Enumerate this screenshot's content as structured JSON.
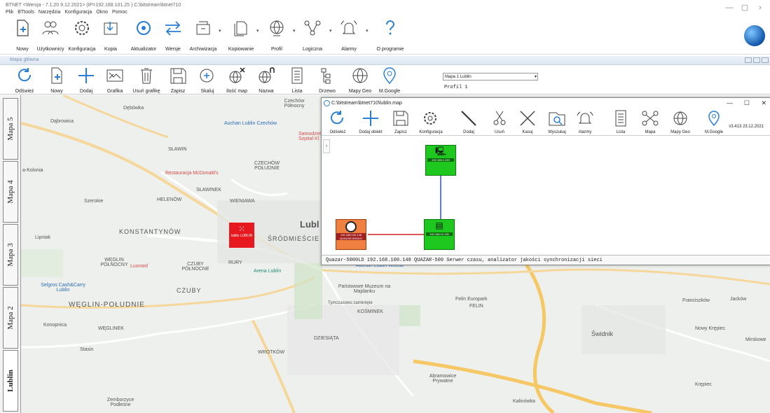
{
  "app": {
    "title": "BTNET   <Wersja - 7.1.20 9.12.2021>  (IP=192.168.101.25 )  C:\\bitstream\\btnet710",
    "menu": [
      "Plik",
      "BTtools",
      "Narzędzia",
      "Konfiguracja",
      "Okno",
      "Pomoc"
    ]
  },
  "main_toolbar": [
    {
      "label": "Nowy",
      "icon": "new-doc-icon"
    },
    {
      "label": "Użytkownicy",
      "icon": "users-icon"
    },
    {
      "label": "Konfiguracja",
      "icon": "config-icon"
    },
    {
      "label": "Kopia",
      "icon": "copy-icon"
    },
    {
      "label": "Aktualizator",
      "icon": "update-icon"
    },
    {
      "label": "Wersje",
      "icon": "versions-icon"
    },
    {
      "label": "Archiwizacja",
      "icon": "archive-icon"
    },
    {
      "label": "Kopiowanie",
      "icon": "copying-icon"
    },
    {
      "label": "Profil",
      "icon": "globe-icon"
    },
    {
      "label": "Logiczna",
      "icon": "logical-icon"
    },
    {
      "label": "Alarmy",
      "icon": "bell-icon"
    },
    {
      "label": "O programie",
      "icon": "help-icon"
    }
  ],
  "map_window": {
    "title": "Mapa główna",
    "toolbar": [
      {
        "label": "Odśwież"
      },
      {
        "label": "Nowy"
      },
      {
        "label": "Dodaj"
      },
      {
        "label": "Grafika"
      },
      {
        "label": "Usuń grafikę"
      },
      {
        "label": "Zapisz"
      },
      {
        "label": "Skaluj"
      },
      {
        "label": "Ilość map"
      },
      {
        "label": "Nazwa"
      },
      {
        "label": "Lista"
      },
      {
        "label": "Drzewo"
      },
      {
        "label": "Mapy Geo"
      },
      {
        "label": "M.Google"
      }
    ],
    "map_select": "Mapa 1 Lublin",
    "profil": "Profil 1",
    "side_tabs": [
      "Mapa 5",
      "Mapa 4",
      "Mapa 3",
      "Mapa 2",
      "Lublin"
    ],
    "map_labels": [
      "Dębówka",
      "Dąbrowica",
      "Czechów Północny",
      "Auchan Lublin Czechów",
      "SŁAWIN",
      "Samodzielny Szpital Kl",
      "Restauracja McDonald's",
      "CZECHÓW POŁUDNIE",
      "a-Kolonia",
      "SŁAWINEK",
      "HELENÓW",
      "WIENIAWA",
      "Szerokie",
      "KONSTANTYNÓW",
      "Lubl",
      "Lipniak",
      "ŚRÓDMIEŚCIE",
      "WĘGLIN PÓŁNOCNY",
      "Luxmed",
      "CZUBY PÓŁNOCNE",
      "RURY",
      "Arena Lublin",
      "Selgros Cash&Carry Lublin",
      "CZUBY",
      "WĘGLIN-POŁUDNIE",
      "Konopnica",
      "WĘGLINEK",
      "Stasin",
      "Zemborzyce Podleśne",
      "Państwowe Muzeum na Majdanku",
      "Tymczasowo zamknięte",
      "KOŚMINEK",
      "DZIESIĄTA",
      "WROTKÓW",
      "Abramowice Prywatne",
      "Felin Europark",
      "FELIN",
      "Świdnik",
      "Franciszków",
      "Jacków",
      "Nowy Krępiec",
      "Mirskowe",
      "Krępiec",
      "Kalinówka",
      "Auchan Lublin Witosa"
    ],
    "red_node": "lublin LUBLIN"
  },
  "sub_window": {
    "title": "C:\\bitstream\\btnet710\\lublin.map",
    "version": "v3.413 23.12.2021",
    "toolbar": [
      {
        "label": "Odśwież"
      },
      {
        "label": "Dodaj obiekt"
      },
      {
        "label": "Zapisz"
      },
      {
        "label": "Konfiguracja"
      },
      {
        "label": "Dodaj"
      },
      {
        "label": "Usuń"
      },
      {
        "label": "Kasuj"
      },
      {
        "label": "Wyszukaj"
      },
      {
        "label": "Alarmy"
      },
      {
        "label": "Lista"
      },
      {
        "label": "Mapa"
      },
      {
        "label": "Mapy Geo"
      },
      {
        "label": "M.Google"
      }
    ],
    "nodes": [
      {
        "label": "192.168.1.220"
      },
      {
        "label": "192.168.100.148 QUAZAR-5000LD"
      },
      {
        "label": "192.168.10.150"
      }
    ],
    "status": "Quazar-5000LD  192.168.100.148   QUAZAR-500   Serwer czasu, analizator jakości synchronizacji sieci"
  }
}
